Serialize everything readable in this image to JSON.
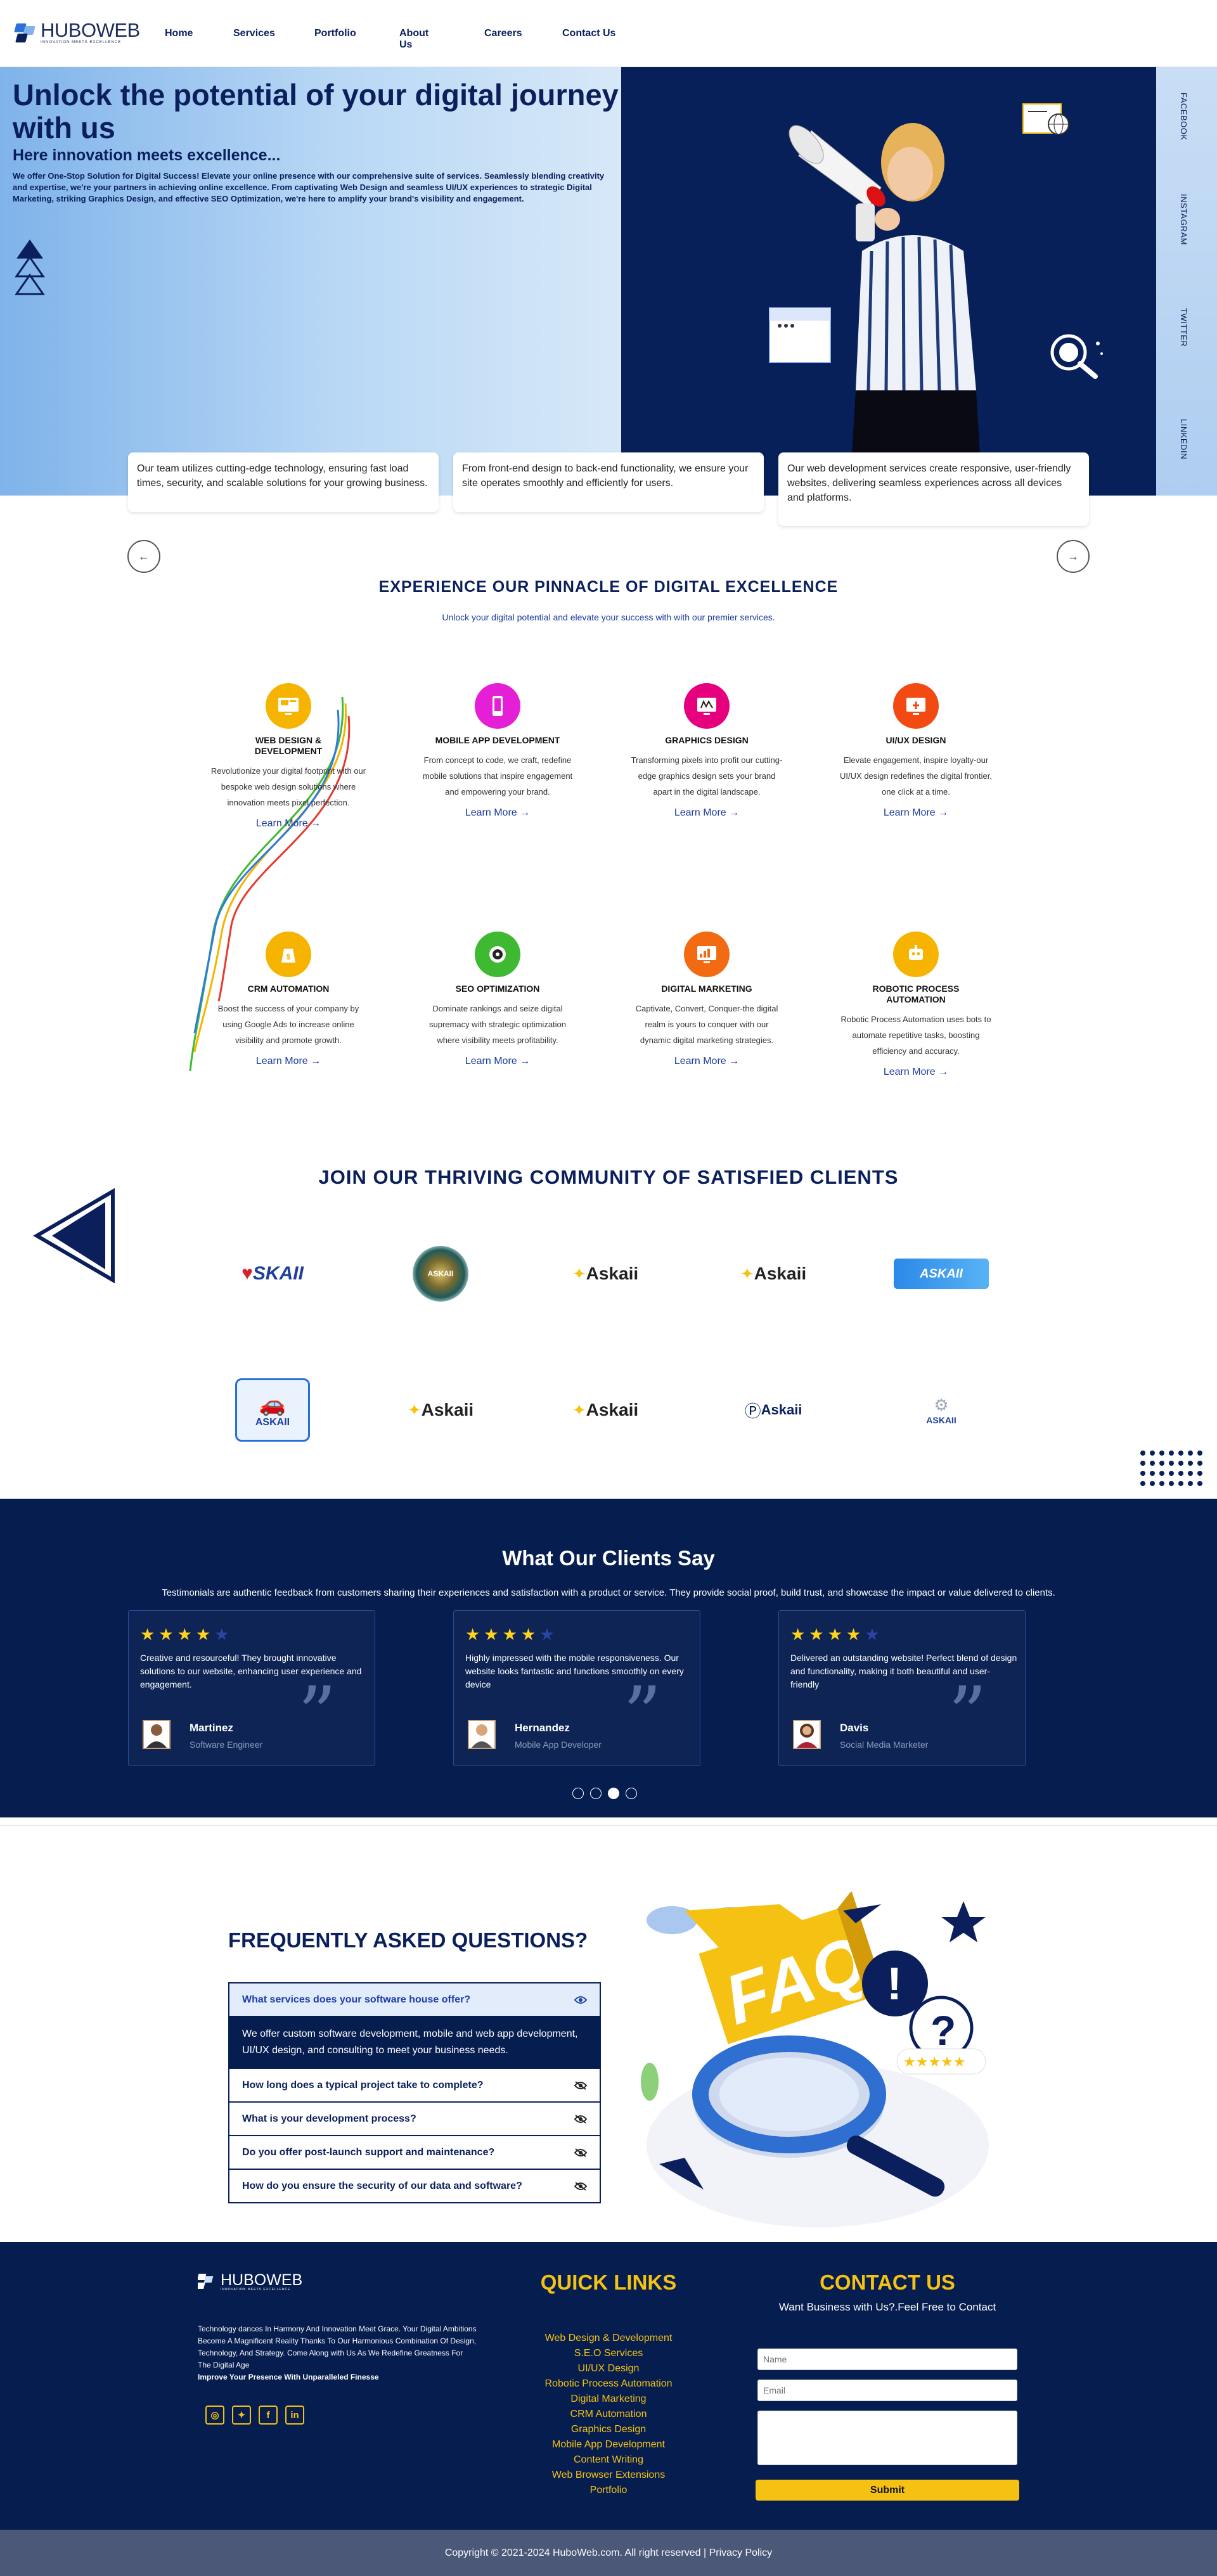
{
  "brand": {
    "name": "HUBOWEB",
    "tagline": "INNOVATION MEETS EXCELLENCE"
  },
  "nav": {
    "items": [
      "Home",
      "Services",
      "Portfolio",
      "About Us",
      "Careers",
      "Contact Us"
    ]
  },
  "hero": {
    "title": "Unlock the potential of your digital journey with us",
    "subtitle": "Here innovation meets excellence...",
    "body": "We offer One-Stop Solution for Digital Success! Elevate your online presence with our comprehensive suite of services. Seamlessly blending creativity and expertise, we're your partners in achieving online excellence. From captivating Web Design and seamless UI/UX experiences to strategic Digital Marketing, striking Graphics Design, and effective SEO Optimization, we're here to amplify your brand's visibility and engagement.",
    "social": [
      "FACEBOOK",
      "INSTAGRAM",
      "TWITTER",
      "LINKEDIN"
    ],
    "cards": [
      "Our team utilizes cutting-edge technology, ensuring fast load times, security, and scalable solutions for your growing business.",
      "From front-end design to back-end functionality, we ensure your site operates smoothly and efficiently for users.",
      "Our web development services create responsive, user-friendly websites, delivering seamless experiences across all devices and platforms."
    ],
    "prev": "←",
    "next": "→"
  },
  "services": {
    "title": "EXPERIENCE OUR PINNACLE OF DIGITAL EXCELLENCE",
    "subtitle": "Unlock your digital potential and elevate your success with with our premier services.",
    "learn_more": "Learn More →",
    "items": [
      {
        "name": "WEB DESIGN & DEVELOPMENT",
        "desc": "Revolutionize your digital footprint with our bespoke web design solutions where innovation meets pixel perfection.",
        "color": "#f6b400"
      },
      {
        "name": "MOBILE APP DEVELOPMENT",
        "desc": "From concept to code, we craft, redefine mobile solutions that inspire engagement and empowering your brand.",
        "color": "#e51fd6"
      },
      {
        "name": "GRAPHICS DESIGN",
        "desc": "Transforming pixels into profit our cutting-edge graphics design sets your brand apart in the digital landscape.",
        "color": "#e6007e"
      },
      {
        "name": "UI/UX DESIGN",
        "desc": "Elevate engagement, inspire loyalty-our UI/UX design redefines the digital frontier, one click at a time.",
        "color": "#f24a12"
      },
      {
        "name": "CRM AUTOMATION",
        "desc": "Boost the success of your company by using Google Ads to increase online visibility and promote growth.",
        "color": "#f6b400"
      },
      {
        "name": "SEO OPTIMIZATION",
        "desc": "Dominate rankings and seize digital supremacy with strategic optimization where visibility meets profitability.",
        "color": "#3fb832"
      },
      {
        "name": "DIGITAL MARKETING",
        "desc": "Captivate, Convert, Conquer-the digital realm is yours to conquer with our dynamic digital marketing strategies.",
        "color": "#f26a12"
      },
      {
        "name": "ROBOTIC PROCESS AUTOMATION",
        "desc": "Robotic Process Automation uses bots to automate repetitive tasks, boosting efficiency and accuracy.",
        "color": "#f6b400"
      }
    ]
  },
  "clients": {
    "title": "JOIN OUR THRIVING COMMUNITY OF SATISFIED CLIENTS",
    "logos": [
      "SKAII",
      "ASKAII",
      "Askaii",
      "Askaii",
      "ASKAII",
      "ASKAII",
      "Askaii",
      "Askaii",
      "Askaii",
      "ASKAII"
    ]
  },
  "testimonials": {
    "title": "What Our Clients Say",
    "intro": "Testimonials are authentic feedback from customers sharing their experiences and satisfaction with a product or service. They provide social proof, build trust, and showcase the impact or value delivered to clients.",
    "items": [
      {
        "rating": 4,
        "text": "Creative and resourceful! They brought innovative solutions to our website, enhancing user experience and engagement.",
        "name": "Martinez",
        "role": "Software Engineer"
      },
      {
        "rating": 4,
        "text": "Highly impressed with the mobile responsiveness. Our website looks fantastic and functions smoothly on every device",
        "name": "Hernandez",
        "role": "Mobile App Developer"
      },
      {
        "rating": 4,
        "text": "Delivered an outstanding website! Perfect blend of design and functionality, making it both beautiful and user-friendly",
        "name": "Davis",
        "role": "Social Media Marketer"
      }
    ],
    "active_dot": 3
  },
  "faq": {
    "title": "FREQUENTLY ASKED QUESTIONS?",
    "items": [
      {
        "q": "What services does your software house offer?",
        "a": "We offer custom software development, mobile and web app development, UI/UX design, and consulting to meet your business needs."
      },
      {
        "q": "How long does a typical project take to complete?"
      },
      {
        "q": "What is your development process?"
      },
      {
        "q": "Do you offer post-launch support and maintenance?"
      },
      {
        "q": "How do you ensure the security of our data and software?"
      }
    ]
  },
  "footer": {
    "about": "Technology dances In Harmony And Innovation Meet Grace. Your Digital Ambitions Become A Magnificent Reality Thanks To Our Harmonious Combination Of Design, Technology, And Strategy. Come Along with Us As We Redefine Greatness For The Digital Age",
    "about_bold": "Improve Your Presence With Unparalleled Finesse",
    "quick_links_title": "QUICK LINKS",
    "quick_links": [
      "Web Design & Development",
      "S.E.O Services",
      "UI/UX Design",
      "Robotic Process Automation",
      "Digital Marketing",
      "CRM Automation",
      "Graphics Design",
      "Mobile App Development",
      "Content Writing",
      "Web Browser Extensions",
      "Portfolio"
    ],
    "contact_title": "CONTACT US",
    "contact_sub": "Want Business with Us?.Feel Free to Contact",
    "name_placeholder": "Name",
    "email_placeholder": "Email",
    "submit": "Submit",
    "copyright": "Copyright © 2021-2024 HuboWeb.com. All right reserved | Privacy Policy"
  },
  "colors": {
    "navy": "#061d4f",
    "brand_blue": "#0a1f5c",
    "accent_yellow": "#f5c214",
    "star_yellow": "#ffd21e"
  }
}
